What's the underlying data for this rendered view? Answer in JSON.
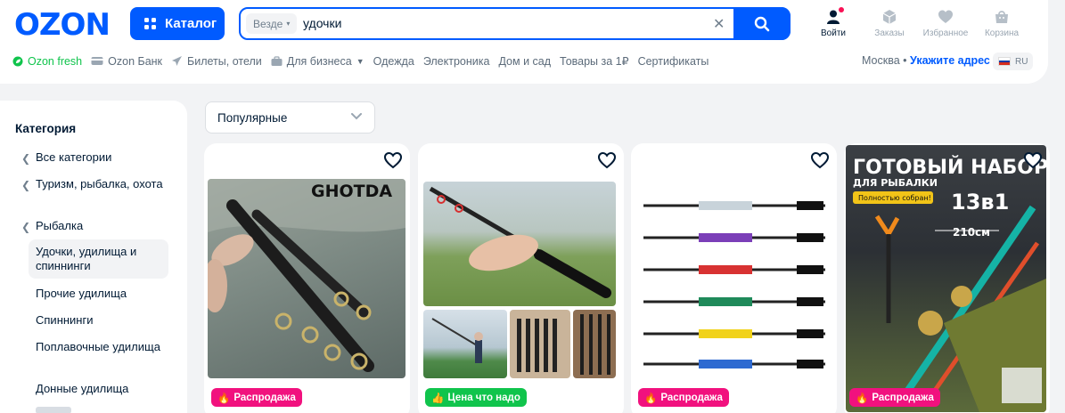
{
  "header": {
    "logo": "OZON",
    "catalog_label": "Каталог",
    "search": {
      "scope": "Везде",
      "query": "удочки"
    },
    "actions": [
      {
        "label": "Войти",
        "icon": "user-icon"
      },
      {
        "label": "Заказы",
        "icon": "box-icon"
      },
      {
        "label": "Избранное",
        "icon": "heart-icon"
      },
      {
        "label": "Корзина",
        "icon": "cart-icon"
      }
    ],
    "nav": [
      "Ozon fresh",
      "Ozon Банк",
      "Билеты, отели",
      "Для бизнеса",
      "Одежда",
      "Электроника",
      "Дом и сад",
      "Товары за 1₽",
      "Сертификаты"
    ],
    "city": "Москва",
    "address_link": "Укажите адрес",
    "lang": "RU"
  },
  "sidebar": {
    "title": "Категория",
    "items": [
      "Все категории",
      "Туризм, рыбалка, охота",
      "Рыбалка",
      "Удочки, удилища и спиннинги",
      "Прочие удилища",
      "Спиннинги",
      "Поплавочные удилища",
      "Донные удилища"
    ]
  },
  "sort": {
    "label": "Популярные"
  },
  "products": [
    {
      "badge": "Распродажа",
      "badge_color": "#f1117e",
      "brand_text": "GHOTDA"
    },
    {
      "badge": "Цена что надо",
      "badge_color": "#10c44c"
    },
    {
      "badge": "Распродажа",
      "badge_color": "#f1117e"
    },
    {
      "badge": "Распродажа",
      "badge_color": "#f1117e",
      "promo": {
        "title": "ГОТОВЫЙ НАБОР",
        "subtitle": "ДЛЯ РЫБАЛКИ",
        "tag": "Полностью собран!",
        "count": "13в1",
        "length": "210см"
      }
    }
  ],
  "colors": {
    "brand": "#005bff",
    "sale": "#f1117e",
    "good_price": "#10c44c"
  }
}
